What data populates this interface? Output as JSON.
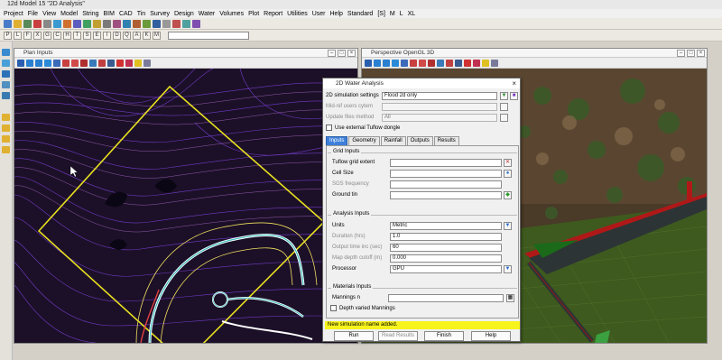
{
  "app": {
    "title": "12d Model 15 \"2D Analysis\""
  },
  "menu": [
    "Project",
    "File",
    "View",
    "Model",
    "String",
    "BIM",
    "CAD",
    "Tin",
    "Survey",
    "Design",
    "Water",
    "Volumes",
    "Plot",
    "Report",
    "Utilities",
    "User",
    "Help",
    "Standard",
    "[S]",
    "M",
    "L",
    "XL"
  ],
  "letters_toolbar": [
    "P",
    "L",
    "F",
    "X",
    "G",
    "C",
    "H",
    "T",
    "S",
    "E",
    "I",
    "D",
    "Q",
    "A",
    "K",
    "M"
  ],
  "plan_window": {
    "title": "Plan Inputs"
  },
  "perspective_window": {
    "title": "Perspective OpenGL 3D"
  },
  "dialog": {
    "title": "2D Water Analysis",
    "sim_settings_label": "2D simulation settings",
    "sim_settings_value": "Flood 2d only",
    "mid_nif_label": "Mid-nif users cytem",
    "update_files_label": "Update files method",
    "update_files_value": "All",
    "tuflow_label": "Use external Tuflow dongle",
    "tabs": [
      "Inputs",
      "Geometry",
      "Rainfall",
      "Outputs",
      "Results"
    ],
    "grid_inputs": {
      "title": "Grid Inputs",
      "tuflow_extent": "Tuflow grid extent",
      "cell_size": "Cell Size",
      "sgs_frequency": "SGS frequency",
      "ground_tin": "Ground tin"
    },
    "analysis_inputs": {
      "title": "Analysis Inputs",
      "units_label": "Units",
      "units_value": "Metric",
      "duration_label": "Duration (hrs)",
      "duration_value": "1.0",
      "output_time_label": "Output time inc (sec)",
      "output_time_value": "60",
      "map_depth_label": "Map depth cutoff (m)",
      "map_depth_value": "0.000",
      "processor_label": "Processor",
      "processor_value": "GPU"
    },
    "materials_inputs": {
      "title": "Materials Inputs",
      "mannings_label": "Mannings n",
      "depth_varied_label": "Depth varied Mannings"
    },
    "status_message": "New simulation name added.",
    "buttons": {
      "run": "Run",
      "read_results": "Read Results",
      "finish": "Finish",
      "help": "Help"
    }
  },
  "colors": {
    "plan_bg": "#1c1028",
    "contour": "#7a3fd6",
    "extent": "#e8e020",
    "status": "#f7f31c",
    "tab_active": "#3d7fd9"
  }
}
